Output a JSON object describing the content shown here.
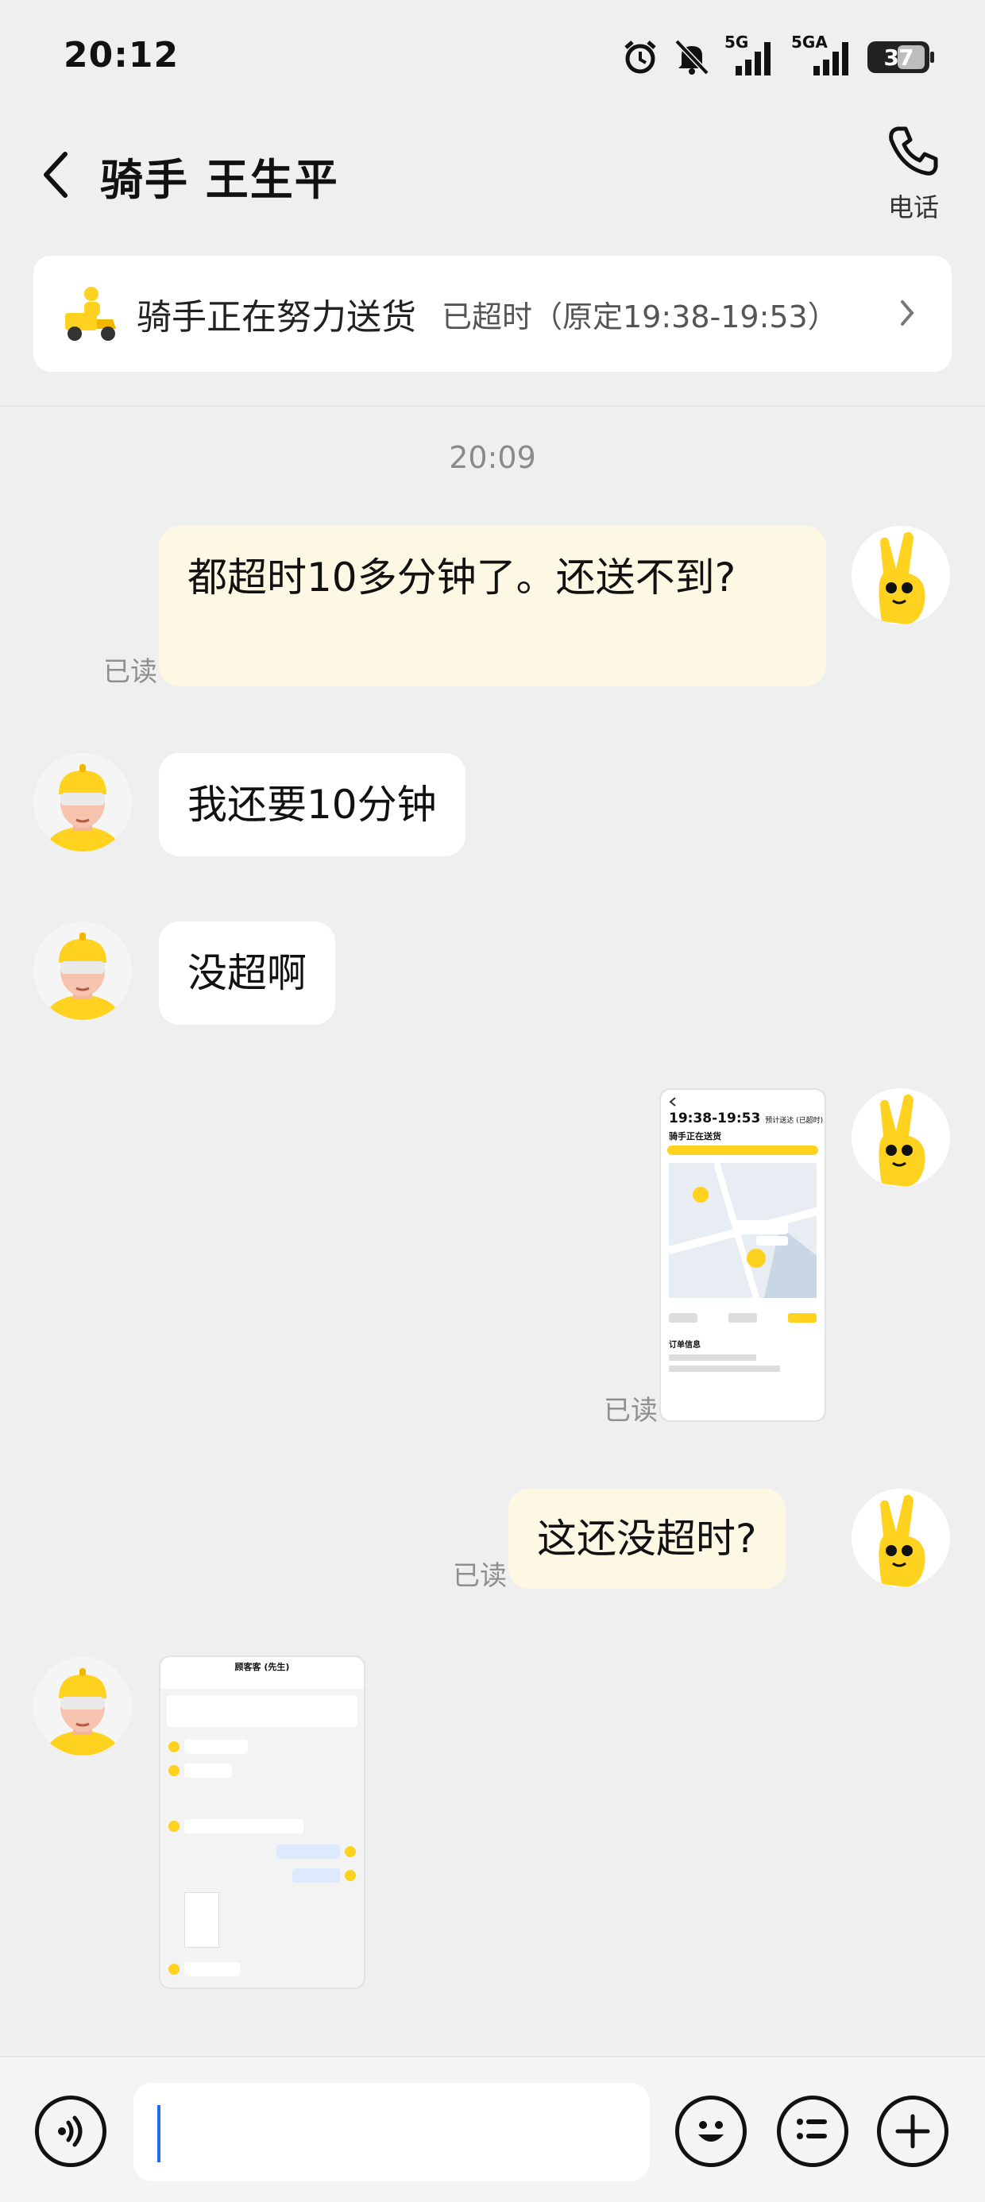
{
  "status_bar": {
    "time": "20:12",
    "network_1": "5G",
    "network_2": "5GA",
    "battery": "37"
  },
  "header": {
    "title": "骑手 王生平",
    "call_label": "电话"
  },
  "delivery": {
    "status": "骑手正在努力送货",
    "detail": "已超时（原定19:38-19:53）"
  },
  "chat": {
    "timestamp": "20:09",
    "read_label": "已读",
    "messages": [
      {
        "from": "me",
        "text": "都超时10多分钟了。还送不到?"
      },
      {
        "from": "rider",
        "text": "我还要10分钟"
      },
      {
        "from": "rider",
        "text": "没超啊"
      },
      {
        "from": "me",
        "type": "screenshot"
      },
      {
        "from": "me",
        "text": "这还没超时?"
      },
      {
        "from": "rider",
        "type": "screenshot"
      }
    ]
  },
  "screenshot_1": {
    "time_range": "19:38-19:53",
    "eta_note": "预计送达 (已超时)",
    "status": "骑手正在送货",
    "section": "订单信息"
  },
  "screenshot_2": {
    "header": "顾客客 (先生)"
  },
  "input": {
    "placeholder": ""
  },
  "colors": {
    "brand_yellow": "#ffd21f",
    "my_bubble": "#fdf8e4",
    "background": "#efefef"
  }
}
